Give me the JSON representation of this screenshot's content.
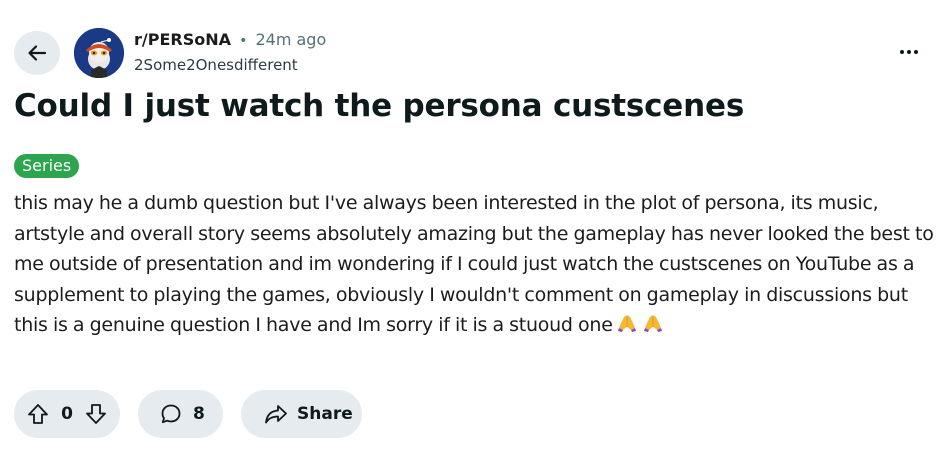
{
  "post": {
    "subreddit": "r/PERSoNA",
    "separator": "•",
    "time_ago": "24m ago",
    "author": "2Some2Onesdifferent",
    "title": "Could I just watch the persona custscenes",
    "flair": "Series",
    "body": "this may he a dumb question but I've always been interested in the plot of persona, its music, artstyle and overall story seems absolutely amazing but the gameplay has never looked the best to me outside of presentation and im wondering if I could just watch the custscenes on YouTube as a supplement to playing the games, obviously I wouldn't comment on gameplay in discussions but this is a genuine question I have and Im sorry if it is a stuoud one",
    "emoji_icons": [
      "folded-hands-icon",
      "folded-hands-icon"
    ]
  },
  "actions": {
    "vote_count": "0",
    "comment_count": "8",
    "share_label": "Share"
  },
  "icons": {
    "back": "arrow-left-icon",
    "more": "ellipsis-icon",
    "upvote": "arrow-up-icon",
    "downvote": "arrow-down-icon",
    "comment": "speech-bubble-icon",
    "share": "share-arrow-icon"
  },
  "colors": {
    "flair_bg": "#2da44e",
    "pill_bg": "#e5ebee",
    "avatar_bg": "#1a3a86",
    "meta_text": "#576f76"
  }
}
